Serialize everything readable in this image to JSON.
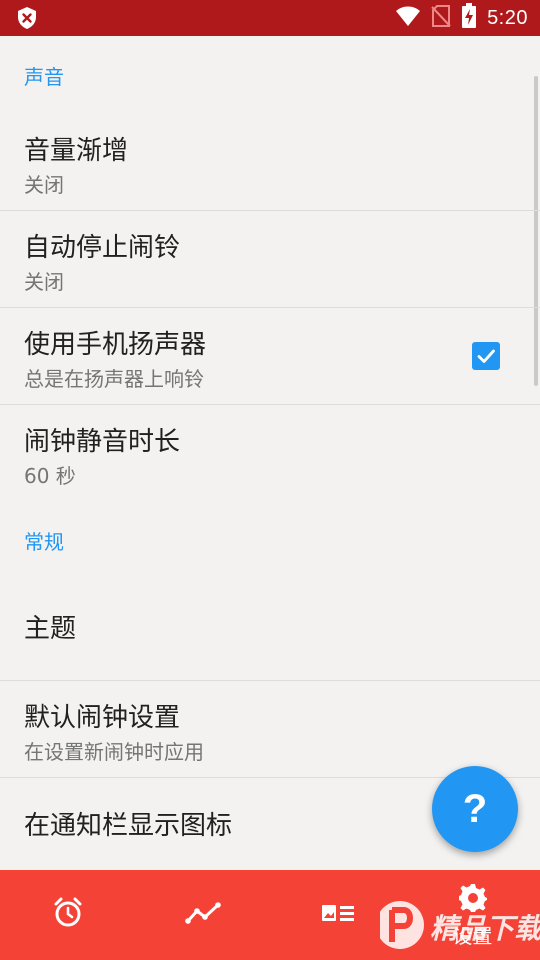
{
  "status_bar": {
    "time": "5:20",
    "icons": [
      "shield-x-icon",
      "wifi-icon",
      "no-sim-icon",
      "battery-charging-icon"
    ]
  },
  "sections": {
    "sound": {
      "header": "声音",
      "volume_increase": {
        "title": "音量渐增",
        "summary": "关闭"
      },
      "auto_stop": {
        "title": "自动停止闹铃",
        "summary": "关闭"
      },
      "use_speaker": {
        "title": "使用手机扬声器",
        "summary": "总是在扬声器上响铃",
        "checked": true
      },
      "silence_duration": {
        "title": "闹钟静音时长",
        "summary": "60 秒"
      }
    },
    "general": {
      "header": "常规",
      "theme": {
        "title": "主题"
      },
      "default_alarm": {
        "title": "默认闹钟设置",
        "summary": "在设置新闹钟时应用"
      },
      "notification_icon": {
        "title": "在通知栏显示图标"
      }
    }
  },
  "fab": {
    "label": "?"
  },
  "bottom_nav": {
    "items": [
      "alarm-icon",
      "stats-icon",
      "cards-icon",
      "gear-icon"
    ],
    "active_label": "设置"
  },
  "watermark": {
    "text": "精品下载"
  },
  "colors": {
    "status_bar": "#b0191c",
    "accent": "#2196f3",
    "bottom_nav": "#f44336",
    "background": "#f3f2f1"
  }
}
